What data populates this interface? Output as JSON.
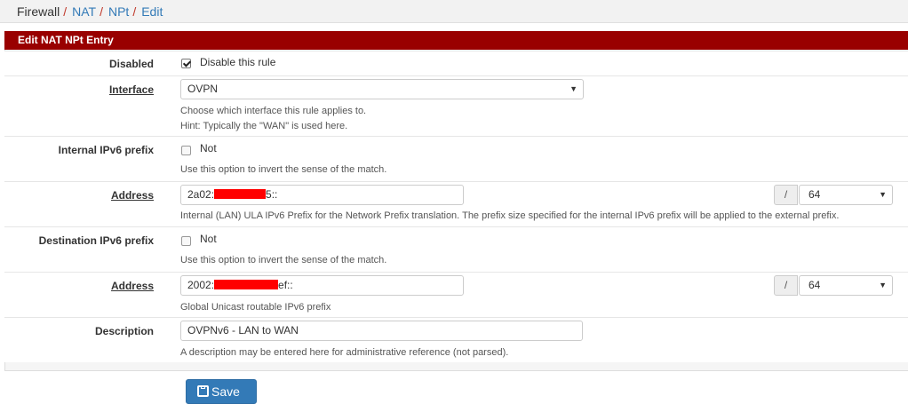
{
  "breadcrumb": {
    "items": [
      "Firewall",
      "NAT",
      "NPt",
      "Edit"
    ],
    "separator": "/"
  },
  "panel": {
    "title": "Edit NAT NPt Entry"
  },
  "disabled": {
    "label": "Disabled",
    "checkbox_label": "Disable this rule",
    "checked": true
  },
  "interface": {
    "label": "Interface",
    "value": "OVPN",
    "help1": "Choose which interface this rule applies to.",
    "help2": "Hint: Typically the \"WAN\" is used here."
  },
  "internal_prefix": {
    "label": "Internal IPv6 prefix",
    "checkbox_label": "Not",
    "help": "Use this option to invert the sense of the match."
  },
  "internal_address": {
    "label": "Address",
    "value_start": "2a02:",
    "value_end": "5::",
    "slash": "/",
    "prefix_len": "64",
    "help": "Internal (LAN) ULA IPv6 Prefix for the Network Prefix translation. The prefix size specified for the internal IPv6 prefix will be applied to the external prefix."
  },
  "destination_prefix": {
    "label": "Destination IPv6 prefix",
    "checkbox_label": "Not",
    "help": "Use this option to invert the sense of the match."
  },
  "destination_address": {
    "label": "Address",
    "value_start": "2002:",
    "value_end": "ef::",
    "slash": "/",
    "prefix_len": "64",
    "help": "Global Unicast routable IPv6 prefix"
  },
  "description": {
    "label": "Description",
    "value": "OVPNv6 - LAN to WAN",
    "help": "A description may be entered here for administrative reference (not parsed)."
  },
  "save_button": {
    "label": "Save",
    "icon": "save-icon"
  },
  "colors": {
    "panel_heading": "#990000",
    "link": "#337ab7",
    "save_button": "#337ab7",
    "redaction": "#ff0000"
  }
}
